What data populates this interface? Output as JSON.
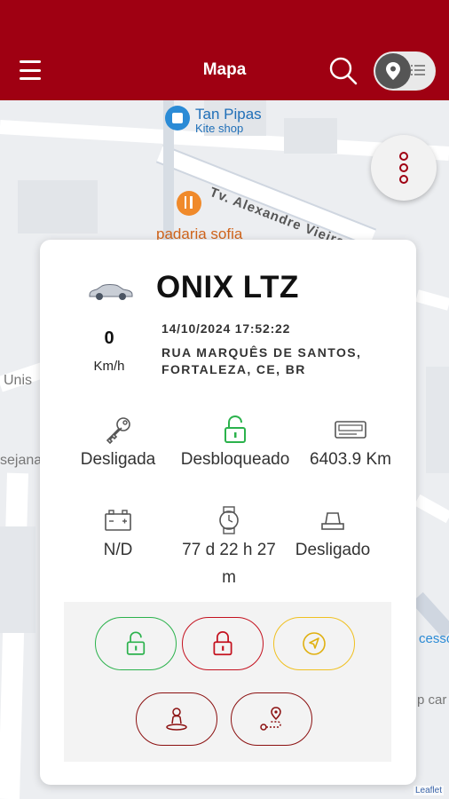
{
  "header": {
    "title": "Mapa",
    "background": "#9f0012"
  },
  "map": {
    "poi_tan_pipas": "Tan Pipas",
    "poi_tan_pipas_sub": "Kite shop",
    "street_alexandre": "Tv. Alexandre Vieira",
    "poi_padaria": "padaria sofia",
    "label_unis": "Unis",
    "label_sejana": "sejana",
    "label_acesso": "cesso",
    "label_p_car": "p car",
    "attribution": "Leaflet"
  },
  "vehicle": {
    "name": "ONIX LTZ",
    "speed": "0",
    "speed_unit": "Km/h",
    "datetime": "14/10/2024 17:52:22",
    "address": "RUA MARQUÊS DE SANTOS, FORTALEZA, CE, BR"
  },
  "stats": {
    "ignition": "Desligada",
    "lock": "Desbloqueado",
    "odometer": "6403.9 Km",
    "battery": "N/D",
    "time": "77 d 22 h 27 m",
    "power": "Desligado"
  },
  "colors": {
    "accent": "#9f0012",
    "unlock_green": "#2bb24c",
    "lock_red": "#c4121f",
    "nav_yellow": "#f0c020"
  },
  "icons": {
    "menu": "hamburger-icon",
    "search": "search-icon",
    "map_pin": "map-pin-icon",
    "list": "list-icon",
    "more": "more-vertical-icon"
  }
}
